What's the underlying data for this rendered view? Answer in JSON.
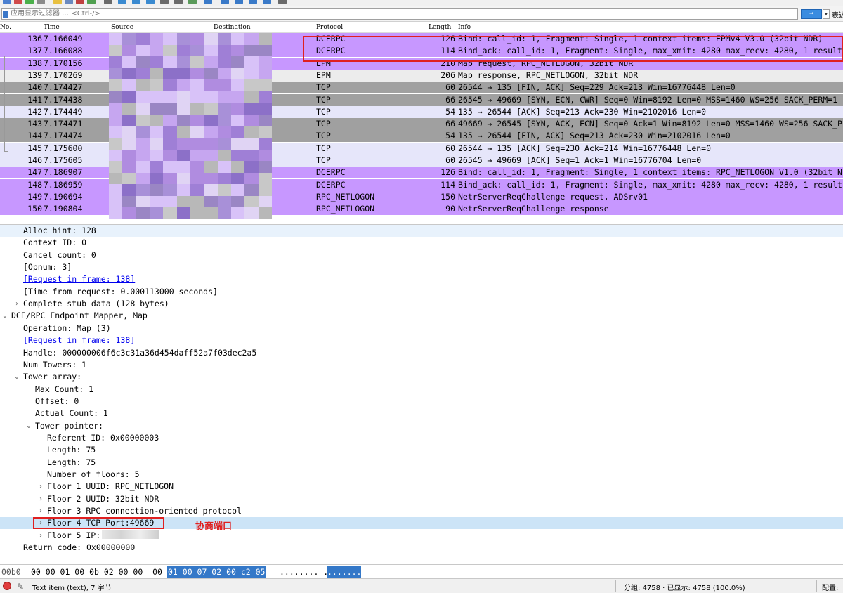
{
  "filter": {
    "placeholder": "应用显示过滤器 … <Ctrl-/>",
    "expression_label": "表达"
  },
  "columns": {
    "no": "No.",
    "time": "Time",
    "source": "Source",
    "destination": "Destination",
    "protocol": "Protocol",
    "length": "Length",
    "info": "Info"
  },
  "packets": [
    {
      "no": "136",
      "time": "7.166049",
      "protocol": "DCERPC",
      "length": "126",
      "info": "Bind: call_id: 1, Fragment: Single, 1 context items: EPMv4 V3.0 (32bit NDR)",
      "bg": "#c797ff"
    },
    {
      "no": "137",
      "time": "7.166088",
      "protocol": "DCERPC",
      "length": "114",
      "info": "Bind_ack: call_id: 1, Fragment: Single, max_xmit: 4280 max_recv: 4280, 1 result",
      "bg": "#c797ff"
    },
    {
      "no": "138",
      "time": "7.170156",
      "protocol": "EPM",
      "length": "210",
      "info": "Map request, RPC_NETLOGON, 32bit NDR",
      "bg": "#c797ff"
    },
    {
      "no": "139",
      "time": "7.170269",
      "protocol": "EPM",
      "length": "206",
      "info": "Map response, RPC_NETLOGON, 32bit NDR",
      "bg": "#ececec"
    },
    {
      "no": "140",
      "time": "7.174427",
      "protocol": "TCP",
      "length": "60",
      "info": "26544 → 135 [FIN, ACK] Seq=229 Ack=213 Win=16776448 Len=0",
      "bg": "#a0a0a0"
    },
    {
      "no": "141",
      "time": "7.174438",
      "protocol": "TCP",
      "length": "66",
      "info": "26545 → 49669 [SYN, ECN, CWR] Seq=0 Win=8192 Len=0 MSS=1460 WS=256 SACK_PERM=1",
      "bg": "#a0a0a0"
    },
    {
      "no": "142",
      "time": "7.174449",
      "protocol": "TCP",
      "length": "54",
      "info": "135 → 26544 [ACK] Seq=213 Ack=230 Win=2102016 Len=0",
      "bg": "#e6e6fa"
    },
    {
      "no": "143",
      "time": "7.174471",
      "protocol": "TCP",
      "length": "66",
      "info": "49669 → 26545 [SYN, ACK, ECN] Seq=0 Ack=1 Win=8192 Len=0 MSS=1460 WS=256 SACK_P",
      "bg": "#a0a0a0"
    },
    {
      "no": "144",
      "time": "7.174474",
      "protocol": "TCP",
      "length": "54",
      "info": "135 → 26544 [FIN, ACK] Seq=213 Ack=230 Win=2102016 Len=0",
      "bg": "#a0a0a0"
    },
    {
      "no": "145",
      "time": "7.175600",
      "protocol": "TCP",
      "length": "60",
      "info": "26544 → 135 [ACK] Seq=230 Ack=214 Win=16776448 Len=0",
      "bg": "#e6e6fa"
    },
    {
      "no": "146",
      "time": "7.175605",
      "protocol": "TCP",
      "length": "60",
      "info": "26545 → 49669 [ACK] Seq=1 Ack=1 Win=16776704 Len=0",
      "bg": "#e6e6fa"
    },
    {
      "no": "147",
      "time": "7.186907",
      "protocol": "DCERPC",
      "length": "126",
      "info": "Bind: call_id: 1, Fragment: Single, 1 context items: RPC_NETLOGON V1.0 (32bit N",
      "bg": "#c797ff"
    },
    {
      "no": "148",
      "time": "7.186959",
      "protocol": "DCERPC",
      "length": "114",
      "info": "Bind_ack: call_id: 1, Fragment: Single, max_xmit: 4280 max_recv: 4280, 1 result",
      "bg": "#c797ff"
    },
    {
      "no": "149",
      "time": "7.190694",
      "protocol": "RPC_NETLOGON",
      "length": "150",
      "info": "NetrServerReqChallenge request, ADSrv01",
      "bg": "#c797ff"
    },
    {
      "no": "150",
      "time": "7.190804",
      "protocol": "RPC_NETLOGON",
      "length": "90",
      "info": "NetrServerReqChallenge response",
      "bg": "#c797ff"
    }
  ],
  "details": [
    {
      "text": "Alloc hint: 128",
      "indent": 1,
      "toggle": "",
      "highlight": true
    },
    {
      "text": "Context ID: 0",
      "indent": 1,
      "toggle": ""
    },
    {
      "text": "Cancel count: 0",
      "indent": 1,
      "toggle": ""
    },
    {
      "text": "[Opnum: 3]",
      "indent": 1,
      "toggle": ""
    },
    {
      "text": "[Request in frame: 138]",
      "indent": 1,
      "toggle": "",
      "link": true
    },
    {
      "text": "[Time from request: 0.000113000 seconds]",
      "indent": 1,
      "toggle": ""
    },
    {
      "text": "Complete stub data (128 bytes)",
      "indent": 1,
      "toggle": ">"
    },
    {
      "text": "DCE/RPC Endpoint Mapper, Map",
      "indent": 0,
      "toggle": "v",
      "section": true
    },
    {
      "text": "Operation: Map (3)",
      "indent": 1,
      "toggle": ""
    },
    {
      "text": "[Request in frame: 138]",
      "indent": 1,
      "toggle": "",
      "link": true
    },
    {
      "text": "Handle: 000000006f6c3c31a36d454daff52a7f03dec2a5",
      "indent": 1,
      "toggle": ""
    },
    {
      "text": "Num Towers: 1",
      "indent": 1,
      "toggle": ""
    },
    {
      "text": "Tower array:",
      "indent": 1,
      "toggle": "v"
    },
    {
      "text": "Max Count: 1",
      "indent": 2,
      "toggle": ""
    },
    {
      "text": "Offset: 0",
      "indent": 2,
      "toggle": ""
    },
    {
      "text": "Actual Count: 1",
      "indent": 2,
      "toggle": ""
    },
    {
      "text": "Tower pointer:",
      "indent": 2,
      "toggle": "v"
    },
    {
      "text": "Referent ID: 0x00000003",
      "indent": 3,
      "toggle": ""
    },
    {
      "text": "Length: 75",
      "indent": 3,
      "toggle": ""
    },
    {
      "text": "Length: 75",
      "indent": 3,
      "toggle": ""
    },
    {
      "text": "Number of floors: 5",
      "indent": 3,
      "toggle": ""
    },
    {
      "text": "Floor 1 UUID: RPC_NETLOGON",
      "indent": 3,
      "toggle": ">"
    },
    {
      "text": "Floor 2 UUID: 32bit NDR",
      "indent": 3,
      "toggle": ">"
    },
    {
      "text": "Floor 3 RPC connection-oriented protocol",
      "indent": 3,
      "toggle": ">"
    },
    {
      "text": "Floor 4 TCP Port:49669",
      "indent": 3,
      "toggle": ">",
      "highlight": true
    },
    {
      "text": "Floor 5 IP:",
      "indent": 3,
      "toggle": ">"
    },
    {
      "text": "Return code: 0x00000000",
      "indent": 1,
      "toggle": ""
    }
  ],
  "annotation": "协商端口",
  "bytes": {
    "offset": "00b0",
    "hex_plain": "00 00 01 00 0b 02 00 00  00",
    "hex_selected": "01 00 07 02 00 c2 05",
    "ascii_plain": "........ .",
    "ascii_selected": "......."
  },
  "status": {
    "item_text": "Text item (text), 7 字节",
    "packets": "分组: 4758 · 已显示: 4758 (100.0%)",
    "profile": "配置:"
  },
  "colors": {
    "dcerpc_row": "#c797ff",
    "tcp_dark_row": "#a0a0a0",
    "tcp_light_row": "#e6e6fa",
    "selection": "#3478c8",
    "annotation_red": "#e02020"
  }
}
